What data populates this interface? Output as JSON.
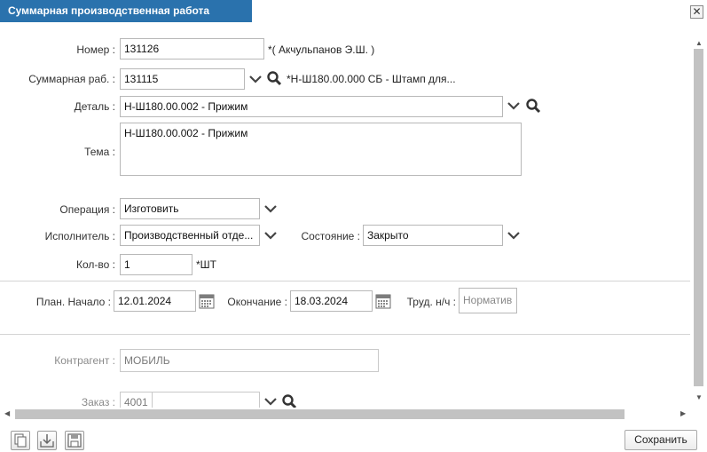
{
  "window": {
    "title": "Суммарная производственная работа",
    "close_glyph": "✕"
  },
  "form": {
    "number": {
      "label": "Номер :",
      "value": "131126",
      "note": "*( Акчульпанов Э.Ш. )"
    },
    "summary_work": {
      "label": "Суммарная раб. :",
      "value": "131115",
      "note": "*Н-Ш180.00.000 СБ - Штамп для..."
    },
    "part": {
      "label": "Деталь :",
      "value": "Н-Ш180.00.002 - Прижим"
    },
    "topic": {
      "label": "Тема :",
      "value": "Н-Ш180.00.002 - Прижим"
    },
    "operation": {
      "label": "Операция :",
      "value": "Изготовить"
    },
    "executor": {
      "label": "Исполнитель :",
      "value": "Производственный отде..."
    },
    "status": {
      "label": "Состояние :",
      "value": "Закрыто"
    },
    "quantity": {
      "label": "Кол-во :",
      "value": "1",
      "unit": "*ШТ"
    },
    "plan_start": {
      "label": "План. Начало :",
      "value": "12.01.2024"
    },
    "end": {
      "label": "Окончание :",
      "value": "18.03.2024"
    },
    "labor": {
      "label": "Труд. н/ч :",
      "placeholder": "Норматив"
    },
    "counterparty": {
      "label": "Контрагент :",
      "value": "МОБИЛЬ"
    },
    "order": {
      "label": "Заказ :",
      "value": "4001"
    }
  },
  "footer": {
    "save_label": "Сохранить"
  },
  "colors": {
    "title_bar": "#2a72ad",
    "scrollbar": "#c2c2c2",
    "border": "#b8b8b8"
  },
  "icons": [
    "close-icon",
    "chevron-down-icon",
    "search-icon",
    "calendar-icon",
    "copy-icon",
    "import-icon",
    "save-disk-icon"
  ]
}
